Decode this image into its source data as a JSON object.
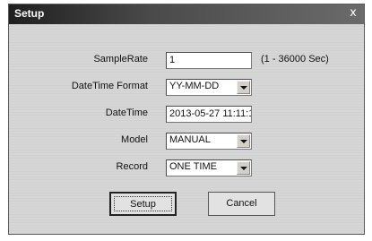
{
  "window": {
    "title": "Setup",
    "close_glyph": "x"
  },
  "form": {
    "sample_rate": {
      "label": "SampleRate",
      "value": "1",
      "range_hint": "(1 - 36000 Sec)"
    },
    "datetime_format": {
      "label": "DateTime Format",
      "value": "YY-MM-DD"
    },
    "datetime": {
      "label": "DateTime",
      "value": "2013-05-27 11:11:1"
    },
    "model": {
      "label": "Model",
      "value": "MANUAL"
    },
    "record": {
      "label": "Record",
      "value": "ONE TIME"
    }
  },
  "buttons": {
    "setup_label": "Setup",
    "cancel_label": "Cancel"
  }
}
